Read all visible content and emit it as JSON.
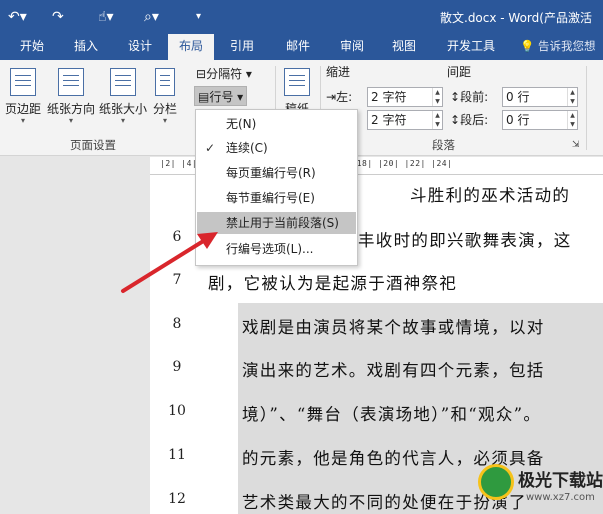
{
  "titlebar": {
    "title": "散文.docx - Word(产品激活",
    "undo_icon": "undo-icon",
    "redo_icon": "redo-icon",
    "touch_mode_icon": "touch-mouse-mode-icon",
    "print_preview_icon": "print-preview-icon",
    "customize_icon": "customize-quick-access-icon",
    "brand_color": "#2b579a"
  },
  "tabs": [
    "开始",
    "插入",
    "设计",
    "布局",
    "引用",
    "邮件",
    "审阅",
    "视图",
    "开发工具"
  ],
  "active_tab": "布局",
  "tell_me": "告诉我您想",
  "ribbon": {
    "page_setup": {
      "margins": "页边距",
      "orientation": "纸张方向",
      "size": "纸张大小",
      "columns": "分栏",
      "breaks": "分隔符",
      "line_numbers": "行号",
      "group_label": "页面设置"
    },
    "draft": "稿纸",
    "paragraph": {
      "indent_label": "缩进",
      "spacing_label": "间距",
      "left_label": "左:",
      "left_value": "2 字符",
      "right_value": "2 字符",
      "before_label": "段前:",
      "before_value": "0 行",
      "after_label": "段后:",
      "after_value": "0 行",
      "group_label": "段落"
    }
  },
  "ruler_text": "|2|  |4|  |6|  |8|  |10|  |12|  |14|  |16|  |18|  |20|  |22|  |24|",
  "dropdown": {
    "items": [
      {
        "label": "无(N)",
        "checked": false
      },
      {
        "label": "连续(C)",
        "checked": true
      },
      {
        "label": "每页重编行号(R)",
        "checked": false
      },
      {
        "label": "每节重编行号(E)",
        "checked": false
      },
      {
        "label": "禁止用于当前段落(S)",
        "checked": false,
        "highlighted": true
      },
      {
        "label": "行编号选项(L)...",
        "checked": false
      }
    ],
    "check_mark": "✓"
  },
  "document": {
    "lines": [
      {
        "number": "",
        "text": "斗胜利的巫术活动的"
      },
      {
        "number": "6",
        "text": "丰收时的即兴歌舞表演，这"
      },
      {
        "number": "7",
        "text": "剧，它被认为是起源于酒神祭祀"
      },
      {
        "number": "8",
        "text": "戏剧是由演员将某个故事或情境，以对"
      },
      {
        "number": "9",
        "text": "演出来的艺术。戏剧有四个元素，包括"
      },
      {
        "number": "10",
        "text": "境）”、“舞台（表演场地）”和“观众”。"
      },
      {
        "number": "11",
        "text": "的元素，他是角色的代言人，必须具备"
      },
      {
        "number": "12",
        "text": "艺术类最大的不同的处便在于扮演了"
      }
    ]
  },
  "annotation": {
    "arrow_color": "#d9262c"
  },
  "watermark": {
    "title": "极光下载站",
    "url": "www.xz7.com"
  }
}
